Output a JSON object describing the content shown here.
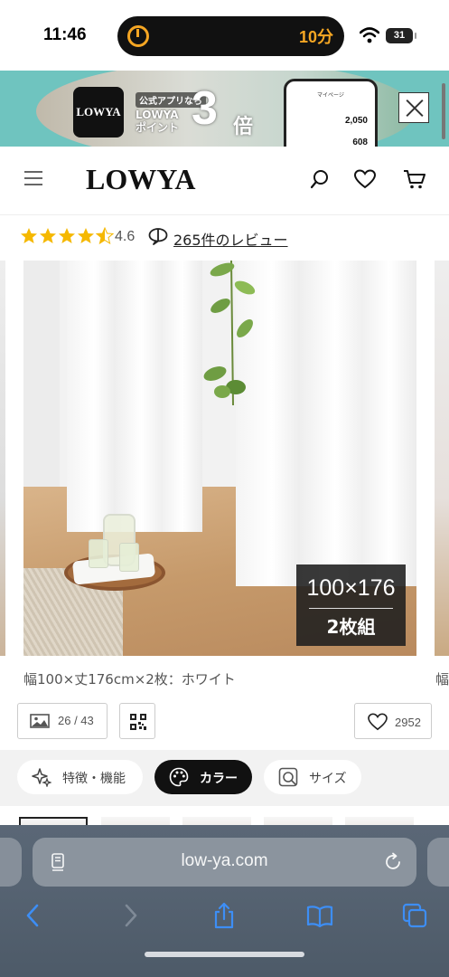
{
  "status_bar": {
    "time": "11:46",
    "timer": "10分",
    "battery": "31"
  },
  "app_banner": {
    "logo_text": "LOWYA",
    "tagline": "公式アプリなら",
    "brand_line1": "LOWYA",
    "brand_line2": "ポイント",
    "multiplier": "3",
    "multiplier_unit": "倍",
    "phone_title": "マイページ",
    "phone_value1": "2,050",
    "phone_value2": "608"
  },
  "header": {
    "logo": "LOWYA"
  },
  "rating": {
    "value": "4.6",
    "stars": 4.5,
    "review_link": "265件のレビュー",
    "star_color": "#f5b800"
  },
  "gallery": {
    "badge_dimensions": "100×176",
    "badge_count": "2枚組",
    "caption": "幅100×丈176cm×2枚：ホワイト",
    "caption_next": "幅"
  },
  "controls": {
    "image_counter": "26 / 43",
    "favorite_count": "2952"
  },
  "tabs": [
    {
      "label": "特徴・機能",
      "icon": "sparkle-icon"
    },
    {
      "label": "カラー",
      "icon": "palette-icon",
      "active": true
    },
    {
      "label": "サイズ",
      "icon": "size-icon"
    }
  ],
  "browser": {
    "url": "low-ya.com"
  }
}
